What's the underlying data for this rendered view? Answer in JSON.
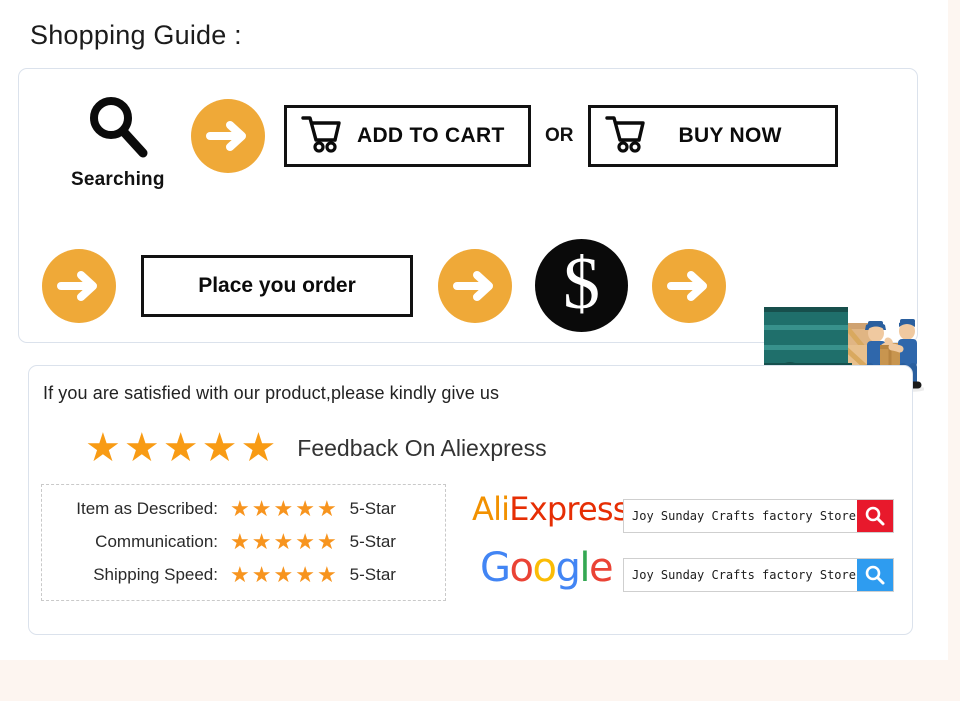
{
  "page": {
    "title": "Shopping Guide :",
    "accent_orange": "#efa938",
    "star_orange": "#f7941e",
    "card_border": "#dbe2ec"
  },
  "guide": {
    "searching": {
      "icon": "magnifier-icon",
      "label": "Searching"
    },
    "arrow_icon": "arrow-right-icon",
    "add_to_cart": {
      "icon": "shopping-cart-icon",
      "label": "ADD TO CART"
    },
    "or_label": "OR",
    "buy_now": {
      "icon": "shopping-cart-icon",
      "label": "BUY NOW"
    },
    "place_order": {
      "label": "Place you order"
    },
    "payment": {
      "icon": "dollar-sign-icon",
      "symbol": "$"
    },
    "delivery": {
      "icon": "delivery-truck-icon"
    }
  },
  "feedback": {
    "intro": "If you are satisfied with our product,please kindly give us",
    "headline_stars": 5,
    "headline_label": "Feedback On Aliexpress",
    "ratings": [
      {
        "label": "Item as Described:",
        "stars": 5,
        "value": "5-Star"
      },
      {
        "label": "Communication:",
        "stars": 5,
        "value": "5-Star"
      },
      {
        "label": "Shipping Speed:",
        "stars": 5,
        "value": "5-Star"
      }
    ],
    "brands": [
      {
        "name": "AliExpress",
        "part1": "Ali",
        "part2": "Express",
        "color1": "#f29100",
        "color2": "#e62e04",
        "search_value": "Joy Sunday Crafts factory Store",
        "button_color": "#e8192c",
        "button_icon": "search-icon"
      },
      {
        "name": "Google",
        "letters": [
          {
            "ch": "G",
            "color": "#4285f4"
          },
          {
            "ch": "o",
            "color": "#ea4335"
          },
          {
            "ch": "o",
            "color": "#fbbc05"
          },
          {
            "ch": "g",
            "color": "#4285f4"
          },
          {
            "ch": "l",
            "color": "#34a853"
          },
          {
            "ch": "e",
            "color": "#ea4335"
          }
        ],
        "search_value": "Joy Sunday Crafts factory Store",
        "button_color": "#2e9cf0",
        "button_icon": "search-icon"
      }
    ]
  }
}
